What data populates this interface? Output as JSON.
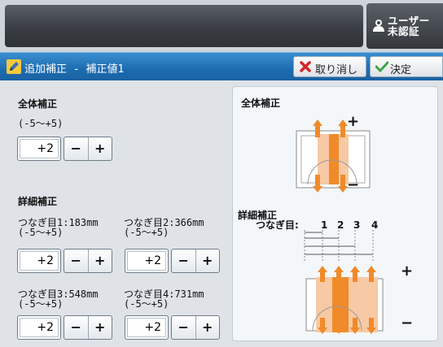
{
  "header": {
    "user_line1": "ユーザー",
    "user_line2": "未認証"
  },
  "titlebar": {
    "title": "追加補正 - 補正値1",
    "cancel": "取り消し",
    "ok": "決定"
  },
  "overall": {
    "heading": "全体補正",
    "range": "(-5〜+5)",
    "value": "+2"
  },
  "detail": {
    "heading": "詳細補正",
    "seams": [
      {
        "label": "つなぎ目1:183mm",
        "range": "(-5〜+5)",
        "value": "+2"
      },
      {
        "label": "つなぎ目2:366mm",
        "range": "(-5〜+5)",
        "value": "+2"
      },
      {
        "label": "つなぎ目3:548mm",
        "range": "(-5〜+5)",
        "value": "+2"
      },
      {
        "label": "つなぎ目4:731mm",
        "range": "(-5〜+5)",
        "value": "+2"
      }
    ]
  },
  "stepper": {
    "minus": "−",
    "plus": "+"
  },
  "diagram": {
    "overall_title": "全体補正",
    "detail_title": "詳細補正",
    "seam_label": "つなぎ目:",
    "seam_numbers": [
      "1",
      "2",
      "3",
      "4"
    ],
    "plus": "+",
    "minus": "−",
    "accent": "#f08a2a"
  }
}
